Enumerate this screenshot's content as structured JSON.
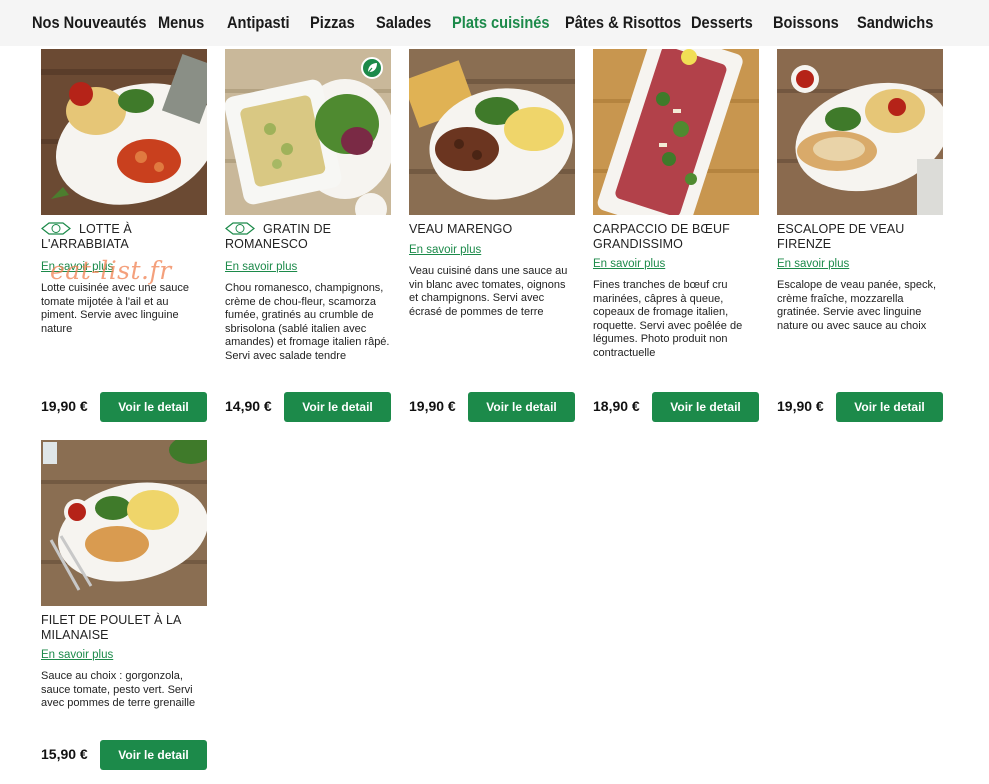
{
  "nav": {
    "items": [
      {
        "label": "Nos Nouveautés",
        "active": false
      },
      {
        "label": "Menus",
        "active": false
      },
      {
        "label": "Antipasti",
        "active": false
      },
      {
        "label": "Pizzas",
        "active": false
      },
      {
        "label": "Salades",
        "active": false
      },
      {
        "label": "Plats cuisinés",
        "active": true
      },
      {
        "label": "Pâtes & Risottos",
        "active": false
      },
      {
        "label": "Desserts",
        "active": false
      },
      {
        "label": "Boissons",
        "active": false
      },
      {
        "label": "Sandwichs",
        "active": false
      }
    ]
  },
  "products": [
    {
      "title": "LOTTE À L'ARRABBIATA",
      "has_badge": true,
      "more": "En savoir plus",
      "description": "Lotte cuisinée avec une sauce tomate mijotée à l'ail et au piment. Servie avec linguine nature",
      "price": "19,90 €",
      "button": "Voir le detail"
    },
    {
      "title": "GRATIN DE ROMANESCO",
      "has_badge": true,
      "vegetarian": true,
      "more": "En savoir plus",
      "description": "Chou romanesco, champignons, crème de chou-fleur, scamorza fumée, gratinés au crumble de sbrisolona (sablé italien avec amandes) et fromage italien râpé. Servi avec salade tendre",
      "price": "14,90 €",
      "button": "Voir le detail"
    },
    {
      "title": "VEAU MARENGO",
      "has_badge": false,
      "more": "En savoir plus",
      "description": "Veau cuisiné dans une sauce au vin blanc avec tomates, oignons et champignons. Servi avec écrasé de pommes de terre",
      "price": "19,90 €",
      "button": "Voir le detail"
    },
    {
      "title": "CARPACCIO DE BŒUF GRANDISSIMO",
      "has_badge": false,
      "more": "En savoir plus",
      "description": "Fines tranches de bœuf cru marinées, câpres à queue, copeaux de fromage italien, roquette. Servi avec poêlée de légumes. Photo produit non contractuelle",
      "price": "18,90 €",
      "button": "Voir le detail"
    },
    {
      "title": "ESCALOPE DE VEAU FIRENZE",
      "has_badge": false,
      "more": "En savoir plus",
      "description": "Escalope de veau panée, speck, crème fraîche, mozzarella gratinée. Servie avec linguine nature ou avec sauce au choix",
      "price": "19,90 €",
      "button": "Voir le detail"
    },
    {
      "title": "FILET DE POULET À LA MILANAISE",
      "has_badge": false,
      "more": "En savoir plus",
      "description": "Sauce au choix : gorgonzola, sauce tomate, pesto vert. Servi avec pommes de terre grenaille",
      "price": "15,90 €",
      "button": "Voir le detail"
    }
  ],
  "watermark": "eat-list.fr",
  "colors": {
    "accent": "#1c8a4a",
    "nav_bg": "#f5f5f5"
  }
}
